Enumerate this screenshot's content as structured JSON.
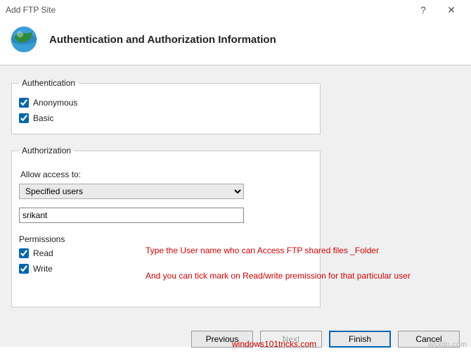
{
  "titlebar": {
    "title": "Add FTP Site",
    "help": "?",
    "close": "✕"
  },
  "header": {
    "heading": "Authentication and Authorization Information"
  },
  "authentication": {
    "legend": "Authentication",
    "anonymous_label": "Anonymous",
    "anonymous_checked": true,
    "basic_label": "Basic",
    "basic_checked": true
  },
  "authorization": {
    "legend": "Authorization",
    "allow_label": "Allow access to:",
    "select_value": "Specified users",
    "username_value": "srikant",
    "permissions_label": "Permissions",
    "read_label": "Read",
    "read_checked": true,
    "write_label": "Write",
    "write_checked": true
  },
  "annotations": {
    "line1": "Type the User name who can Access FTP shared files _Folder",
    "line2": "And you can tick mark on Read/write premission for that particular user"
  },
  "footer": {
    "previous": "Previous",
    "next": "Next",
    "finish": "Finish",
    "cancel": "Cancel"
  },
  "watermarks": {
    "w1": "windows101tricks.com",
    "w2": "wsxdn.com"
  }
}
